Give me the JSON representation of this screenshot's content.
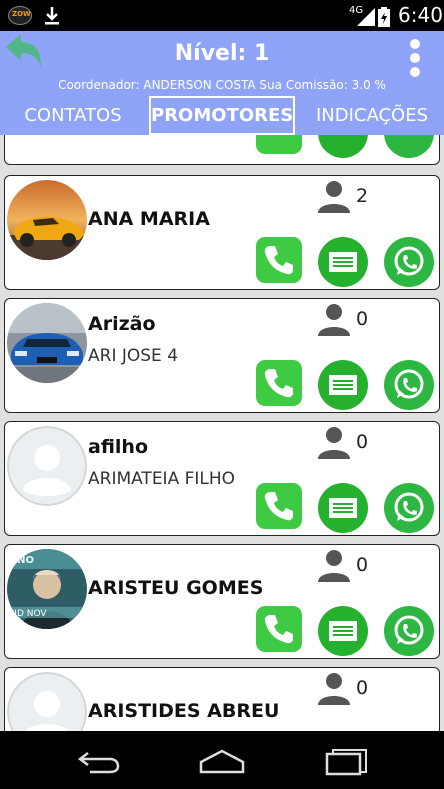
{
  "status_bar": {
    "app_badge": "ZOW",
    "network": "4G",
    "time": "6:40",
    "icons": [
      "app-badge-icon",
      "download-icon",
      "signal-icon",
      "battery-icon"
    ]
  },
  "header": {
    "title": "Nível: 1",
    "coordinator_line": "Coordenador: ANDERSON COSTA Sua Comissão: 3.0 %",
    "tabs": [
      {
        "label": "CONTATOS",
        "active": false
      },
      {
        "label": "PROMOTORES",
        "active": true
      },
      {
        "label": "INDICAÇÕES",
        "active": false
      }
    ]
  },
  "promoters": [
    {
      "name": "ANA MARIA",
      "subtitle": "",
      "count": "2",
      "avatar": "sports-car-photo"
    },
    {
      "name": "Arizão",
      "subtitle": "ARI JOSE 4",
      "count": "0",
      "avatar": "blue-car-photo"
    },
    {
      "name": "afilho",
      "subtitle": "ARIMATEIA FILHO",
      "count": "0",
      "avatar": "default-avatar"
    },
    {
      "name": "ARISTEU GOMES",
      "subtitle": "",
      "count": "0",
      "avatar": "poster-photo"
    },
    {
      "name": "ARISTIDES ABREU",
      "subtitle": "",
      "count": "0",
      "avatar": "default-avatar"
    }
  ],
  "partial_card_top": {
    "visible": true
  },
  "poster_text": {
    "top": "UNO",
    "bottom": "CID NOV"
  },
  "colors": {
    "header": "#8fa3f8",
    "back_arrow": "#52b788",
    "phone_button": "#3ecb43",
    "sms_button": "#25b12d",
    "whatsapp_button": "#2db742"
  }
}
